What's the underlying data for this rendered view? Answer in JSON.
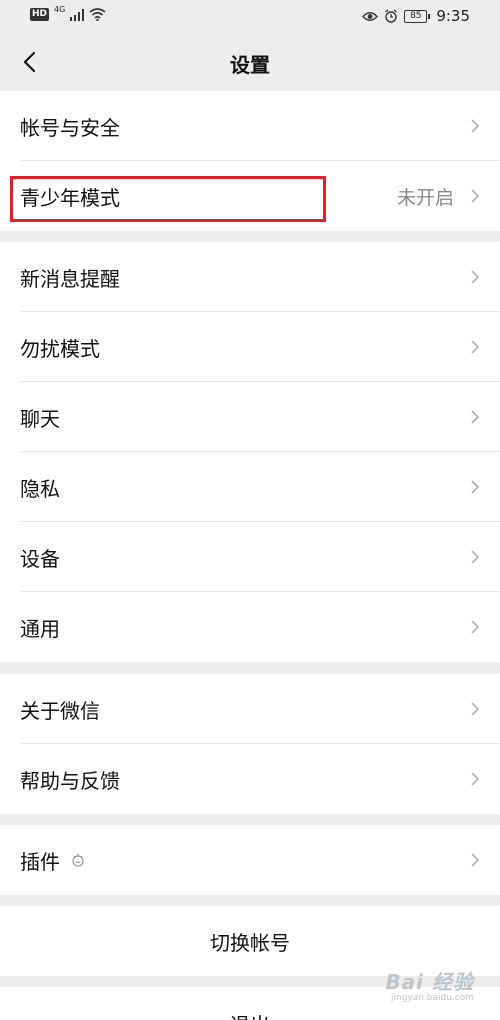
{
  "status_bar": {
    "hd": "HD",
    "network": "4G",
    "battery": "85",
    "time": "9:35"
  },
  "header": {
    "title": "设置"
  },
  "groups": [
    {
      "items": [
        {
          "label": "帐号与安全",
          "value": ""
        },
        {
          "label": "青少年模式",
          "value": "未开启"
        }
      ]
    },
    {
      "items": [
        {
          "label": "新消息提醒"
        },
        {
          "label": "勿扰模式"
        },
        {
          "label": "聊天"
        },
        {
          "label": "隐私"
        },
        {
          "label": "设备"
        },
        {
          "label": "通用"
        }
      ]
    },
    {
      "items": [
        {
          "label": "关于微信"
        },
        {
          "label": "帮助与反馈"
        }
      ]
    },
    {
      "items": [
        {
          "label": "插件"
        }
      ]
    }
  ],
  "actions": {
    "switch_account": "切换帐号",
    "logout": "退出"
  },
  "watermark": {
    "main": "Bai 经验",
    "sub": "jingyan.baidu.com"
  }
}
